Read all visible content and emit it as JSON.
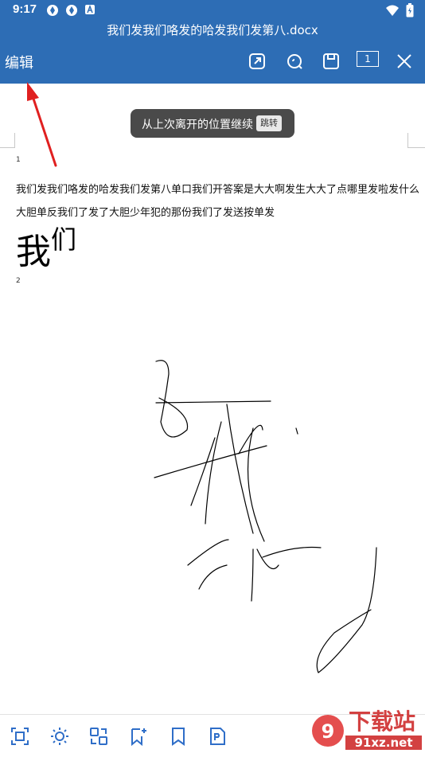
{
  "status_bar": {
    "time": "9:17",
    "left_icons": [
      "swirl-app-icon",
      "swirl-app-icon",
      "a-app-icon"
    ],
    "right_icons": [
      "wifi-icon",
      "battery-icon"
    ]
  },
  "title_bar": {
    "title": "我们发我们咯发的哈发我们发第八.docx"
  },
  "toolbar": {
    "edit_label": "编辑",
    "buttons": [
      "share-export-icon",
      "search-icon",
      "save-icon",
      "page-indicator",
      "close-icon"
    ],
    "page_number": "1"
  },
  "toast": {
    "message": "从上次离开的位置继续",
    "action_label": "跳转"
  },
  "document": {
    "page1_number": "1",
    "line1": "我们发我们咯发的哈发我们发第八单口我们开答案是大大啊发生大大了点哪里发啦发什么",
    "line2": "大胆单反我们了发了大胆少年犯的那份我们了发送按单发",
    "big_main": "我",
    "big_small": "们",
    "page2_number": "2",
    "drawing": "handwritten-sketch"
  },
  "bottom_bar": {
    "icons": [
      "crop-icon",
      "brightness-icon",
      "convert-icon",
      "bookmark-add-icon",
      "bookmark-icon",
      "pdf-icon"
    ]
  },
  "watermark": {
    "brand": "下载站",
    "site": "91xz.net"
  },
  "colors": {
    "primary": "#2d6db5",
    "toast_bg": "#4a4a4a",
    "annotation_arrow": "#e02020",
    "icon_blue": "#2f6ec8"
  }
}
